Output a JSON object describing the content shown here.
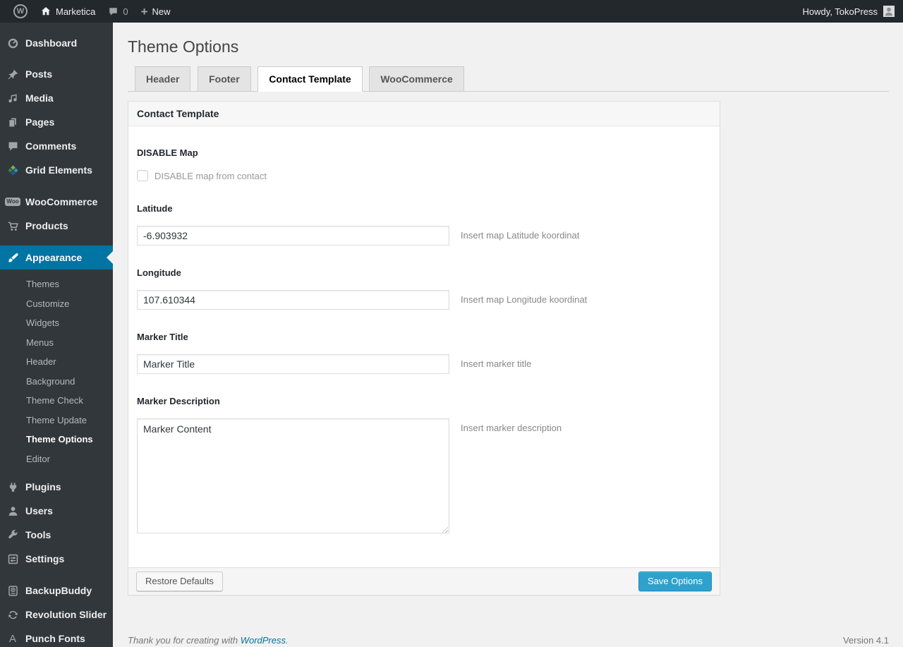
{
  "admin_bar": {
    "wp_logo_glyph": "W",
    "site_name": "Marketica",
    "comments_count": "0",
    "plus_glyph": "+",
    "new_label": "New",
    "howdy": "Howdy, TokoPress"
  },
  "sidebar": {
    "items": {
      "dashboard": "Dashboard",
      "posts": "Posts",
      "media": "Media",
      "pages": "Pages",
      "comments": "Comments",
      "grid_elements": "Grid Elements",
      "woocommerce": "WooCommerce",
      "products": "Products",
      "appearance": "Appearance",
      "plugins": "Plugins",
      "users": "Users",
      "tools": "Tools",
      "settings": "Settings",
      "backupbuddy": "BackupBuddy",
      "revolution_slider": "Revolution Slider",
      "punch_fonts": "Punch Fonts"
    },
    "appearance_submenu": [
      "Themes",
      "Customize",
      "Widgets",
      "Menus",
      "Header",
      "Background",
      "Theme Check",
      "Theme Update",
      "Theme Options",
      "Editor"
    ],
    "current_submenu_item": "Theme Options"
  },
  "icons": {
    "woo_badge": "Woo",
    "punch_fonts_glyph": "A"
  },
  "page": {
    "title": "Theme Options",
    "tabs": [
      "Header",
      "Footer",
      "Contact Template",
      "WooCommerce"
    ],
    "active_tab": "Contact Template"
  },
  "panel": {
    "header": "Contact Template",
    "disable_map": {
      "heading": "DISABLE Map",
      "checkbox_label": "DISABLE map from contact",
      "checked": false
    },
    "latitude": {
      "label": "Latitude",
      "value": "-6.903932",
      "help": "Insert map Latitude koordinat"
    },
    "longitude": {
      "label": "Longitude",
      "value": "107.610344",
      "help": "Insert map Longitude koordinat"
    },
    "marker_title": {
      "label": "Marker Title",
      "value": "Marker Title",
      "help": "Insert marker title"
    },
    "marker_description": {
      "label": "Marker Description",
      "value": "Marker Content",
      "help": "Insert marker description"
    },
    "buttons": {
      "restore": "Restore Defaults",
      "save": "Save Options"
    }
  },
  "page_footer": {
    "thanks_prefix": "Thank you for creating with ",
    "link_label": "WordPress",
    "suffix": ".",
    "version": "Version 4.1"
  },
  "colors": {
    "accent_blue": "#0074a2",
    "button_primary": "#2ea2cc",
    "admin_bar_bg": "#23282d",
    "menu_bg": "#32373c",
    "page_bg": "#f1f1f1"
  }
}
